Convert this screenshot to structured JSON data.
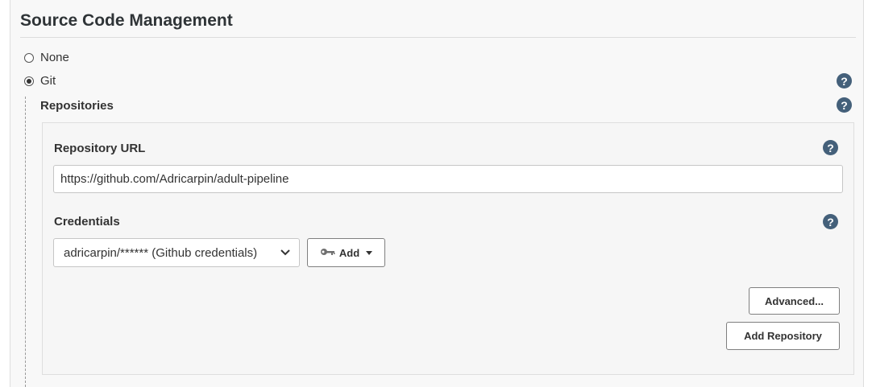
{
  "section": {
    "title": "Source Code Management"
  },
  "scm_options": [
    {
      "label": "None",
      "checked": false
    },
    {
      "label": "Git",
      "checked": true
    }
  ],
  "git": {
    "repositories_label": "Repositories",
    "repository_url": {
      "label": "Repository URL",
      "value": "https://github.com/Adricarpin/adult-pipeline"
    },
    "credentials": {
      "label": "Credentials",
      "selected": "adricarpin/****** (Github credentials)",
      "add_label": "Add",
      "add_icon": "key-icon"
    },
    "advanced_label": "Advanced...",
    "add_repository_label": "Add Repository"
  },
  "help_glyph": "?",
  "colors": {
    "help_icon": "#44607a",
    "panel_bg": "#f8f8f8",
    "border": "#dedede"
  }
}
